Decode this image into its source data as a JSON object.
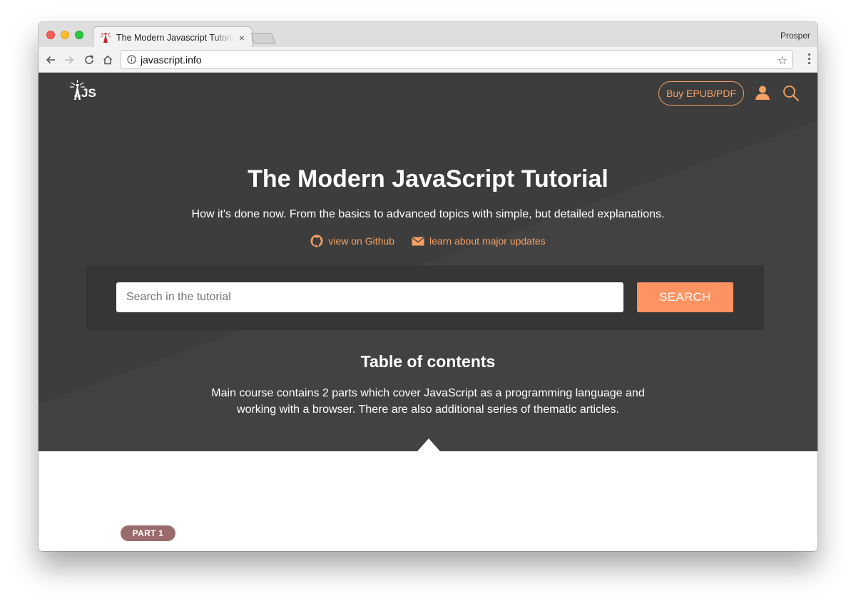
{
  "browser": {
    "tab_title": "The Modern Javascript Tutorial",
    "tab_close": "×",
    "profile_name": "Prosper",
    "url": "javascript.info",
    "star_glyph": "☆"
  },
  "header": {
    "logo_text": "JS",
    "buy_button_label": "Buy EPUB/PDF"
  },
  "hero": {
    "title": "The Modern JavaScript Tutorial",
    "subtitle": "How it's done now. From the basics to advanced topics with simple, but detailed explanations.",
    "github_link": "view on Github",
    "updates_link": "learn about major updates"
  },
  "search": {
    "placeholder": "Search in the tutorial",
    "button_label": "SEARCH"
  },
  "toc": {
    "title": "Table of contents",
    "description": "Main course contains 2 parts which cover JavaScript as a programming language and working with a browser. There are also additional series of thematic articles."
  },
  "part": {
    "badge": "PART 1"
  },
  "colors": {
    "accent": "#f5a163",
    "search_button": "#fd9262",
    "hero_bg": "#3d3d3d",
    "part_badge": "#9a6b6b"
  }
}
